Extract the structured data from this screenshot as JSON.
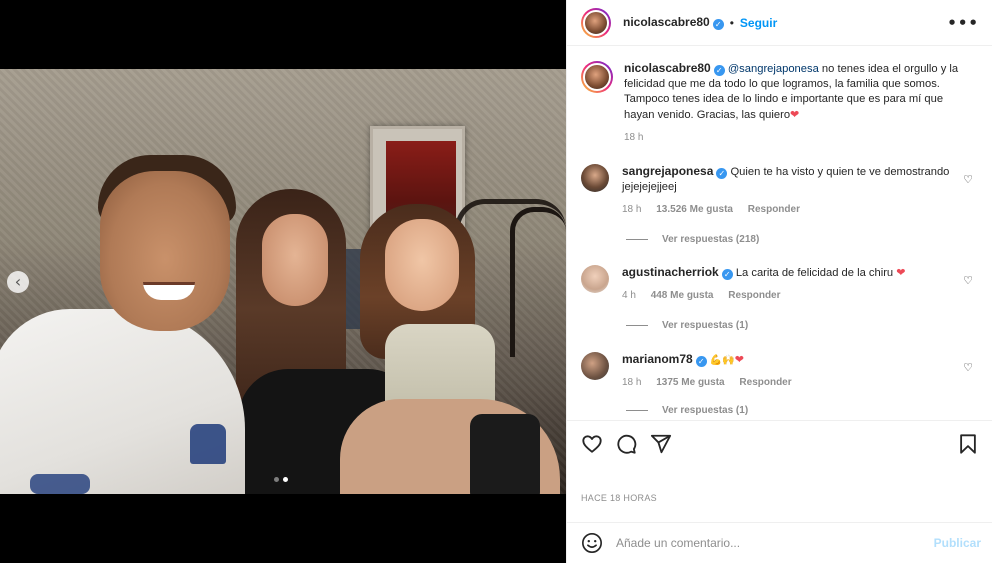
{
  "post": {
    "author": "nicolascabre80",
    "follow_label": "Seguir",
    "separator": "•",
    "more_icon": "more-horizontal-icon",
    "media": {
      "slide_count": 2,
      "active_slide": 2
    }
  },
  "caption": {
    "author": "nicolascabre80",
    "mention": "@sangrejaponesa",
    "text": " no tenes idea el orgullo y la felicidad que me da todo lo que logramos, la familia que somos. Tampoco tenes idea de lo lindo e importante que es para mí que hayan venido. Gracias, las quiero",
    "emoji": "❤",
    "time": "18 h"
  },
  "comments": [
    {
      "user": "sangrejaponesa",
      "text": "Quien te ha visto y quien te ve demostrando jejejejejjeej",
      "emoji": "",
      "time": "18 h",
      "likes": "13.526 Me gusta",
      "reply": "Responder",
      "replies": "Ver respuestas (218)"
    },
    {
      "user": "agustinacherriok",
      "text": "La carita de felicidad de la chiru ",
      "emoji": "❤",
      "time": "4 h",
      "likes": "448 Me gusta",
      "reply": "Responder",
      "replies": "Ver respuestas (1)"
    },
    {
      "user": "marianom78",
      "text": "💪🙌",
      "emoji": "❤",
      "time": "18 h",
      "likes": "1375 Me gusta",
      "reply": "Responder",
      "replies": "Ver respuestas (1)"
    }
  ],
  "actions": {
    "like_icon": "heart-icon",
    "comment_icon": "comment-icon",
    "share_icon": "send-icon",
    "save_icon": "bookmark-icon"
  },
  "time_ago": "HACE 18 HORAS",
  "comment_box": {
    "placeholder": "Añade un comentario...",
    "publish_label": "Publicar"
  },
  "colors": {
    "accent": "#0095f6",
    "verified": "#3897f0",
    "heart": "#ed4956",
    "muted": "#8e8e8e"
  }
}
